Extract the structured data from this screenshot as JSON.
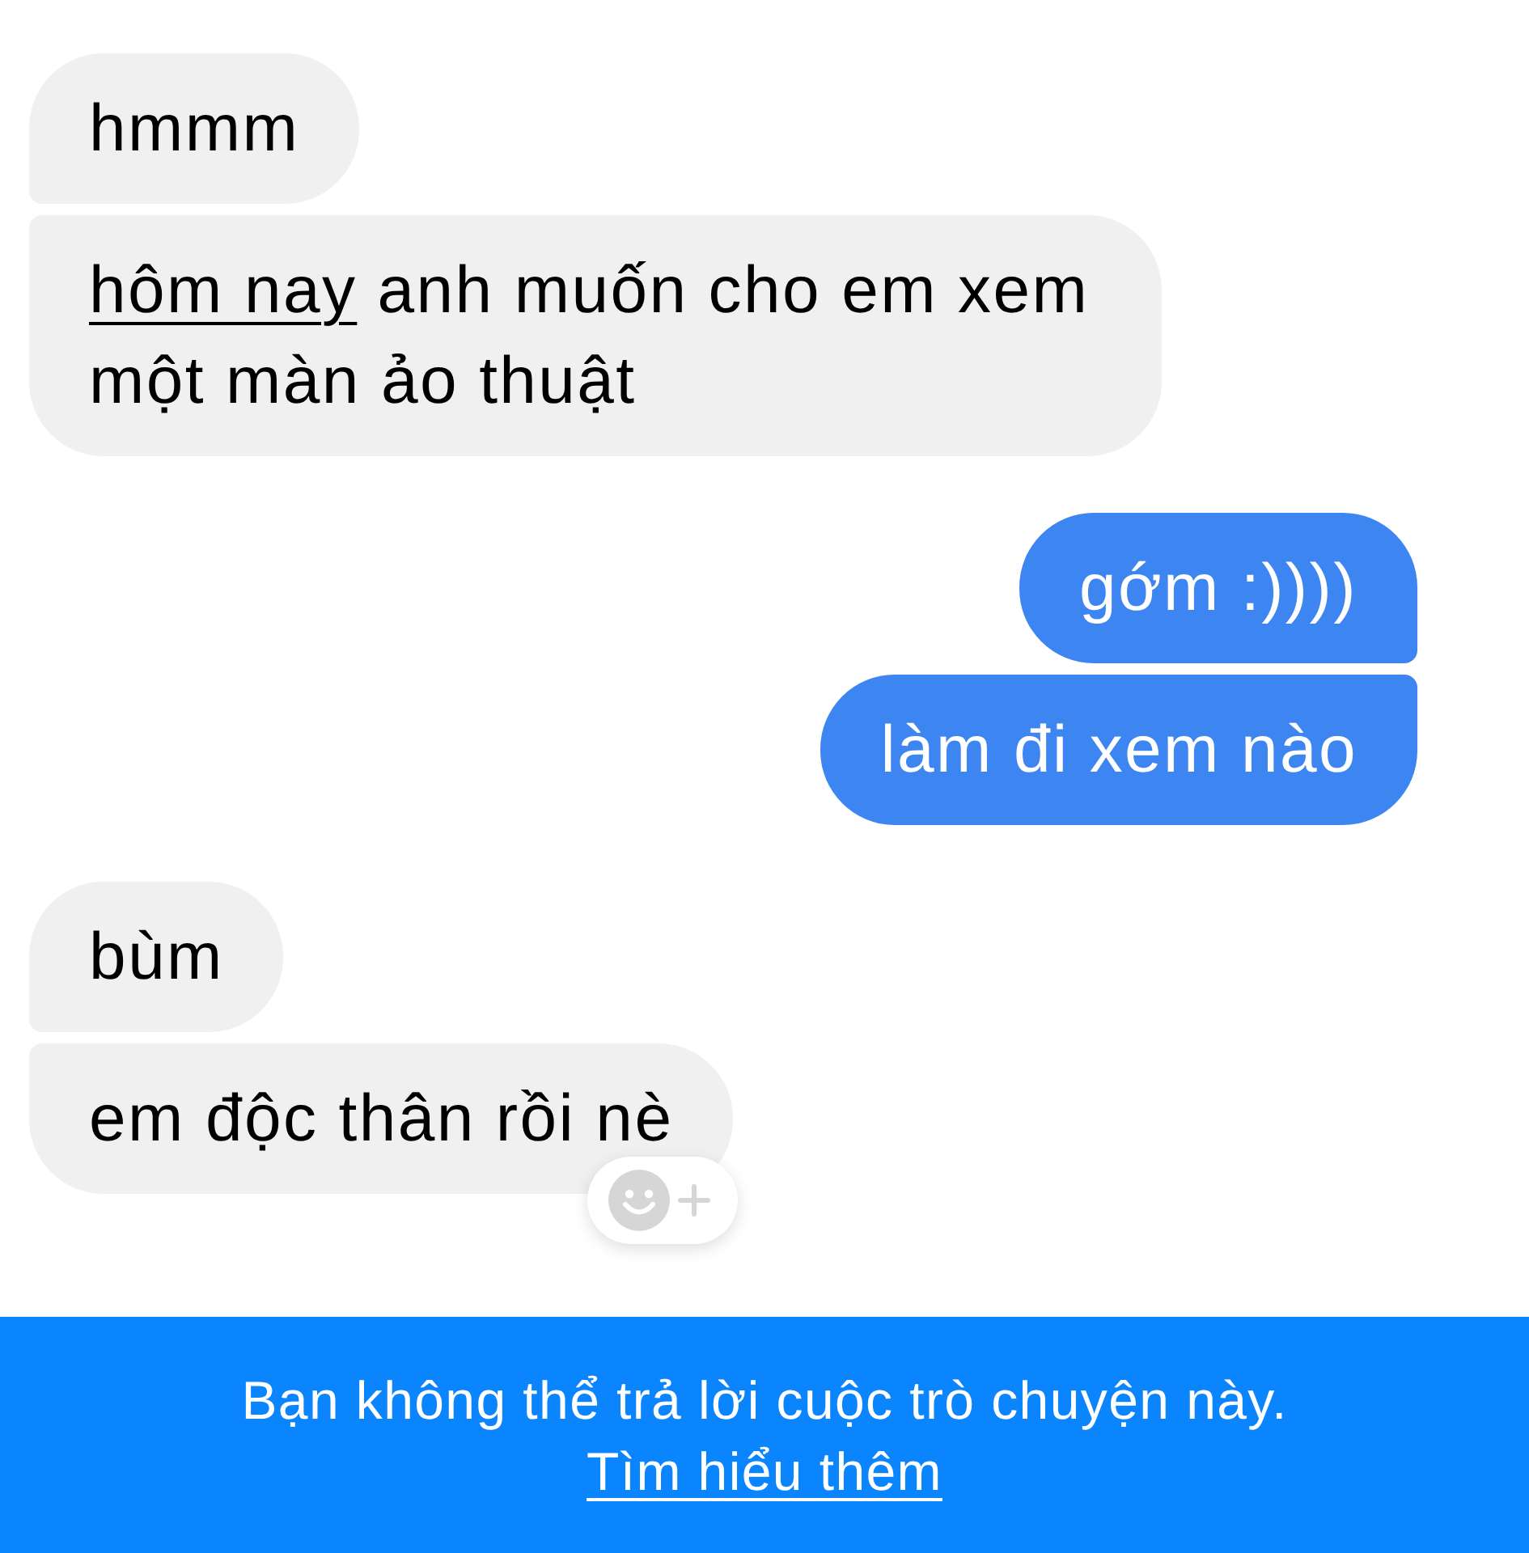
{
  "messages": [
    {
      "kind": "incoming",
      "parts": [
        {
          "kind": "plain",
          "text": "hmmm"
        }
      ],
      "reaction_button": false
    },
    {
      "kind": "incoming",
      "parts": [
        {
          "kind": "link",
          "text": "hôm nay"
        },
        {
          "kind": "plain",
          "text": " anh muốn cho em xem một màn ảo thuật"
        }
      ],
      "reaction_button": false
    },
    {
      "kind": "outgoing",
      "parts": [
        {
          "kind": "plain",
          "text": "gớm :))))"
        }
      ],
      "reaction_button": false
    },
    {
      "kind": "outgoing",
      "parts": [
        {
          "kind": "plain",
          "text": "làm đi xem nào"
        }
      ],
      "reaction_button": false
    },
    {
      "kind": "incoming",
      "parts": [
        {
          "kind": "plain",
          "text": "bùm"
        }
      ],
      "reaction_button": false
    },
    {
      "kind": "incoming",
      "parts": [
        {
          "kind": "plain",
          "text": "em độc thân rồi nè"
        }
      ],
      "reaction_button": true
    }
  ],
  "notice": {
    "text": "Bạn không thể trả lời cuộc trò chuyện này.",
    "link": "Tìm hiểu thêm"
  }
}
